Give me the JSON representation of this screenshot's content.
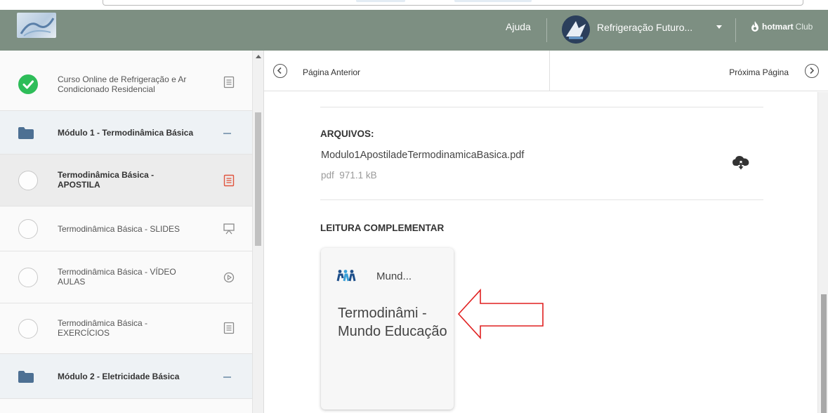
{
  "header": {
    "help_label": "Ajuda",
    "account_name": "Refrigeração Futuro...",
    "brand": "hotmart",
    "brand_suffix": "Club"
  },
  "sidebar": {
    "items": [
      {
        "label": "Curso Online de Refrigeração e Ar Condicionado Residencial",
        "kind": "lesson",
        "status": "completed",
        "icon": "document-icon"
      },
      {
        "label": "Módulo 1 - Termodinâmica Básica",
        "kind": "module",
        "icon": "folder-icon"
      },
      {
        "label": "Termodinâmica Básica - APOSTILA",
        "kind": "lesson",
        "status": "incomplete",
        "active": true,
        "icon": "document-icon"
      },
      {
        "label": "Termodinâmica Básica - SLIDES",
        "kind": "lesson",
        "status": "incomplete",
        "icon": "presentation-icon"
      },
      {
        "label": "Termodinâmica Básica - VÍDEO AULAS",
        "kind": "lesson",
        "status": "incomplete",
        "icon": "play-icon"
      },
      {
        "label": "Termodinâmica Básica - EXERCÍCIOS",
        "kind": "lesson",
        "status": "incomplete",
        "icon": "document-icon"
      },
      {
        "label": "Módulo 2 - Eletricidade Básica",
        "kind": "module",
        "icon": "folder-icon"
      }
    ]
  },
  "pager": {
    "prev_label": "Página Anterior",
    "next_label": "Próxima Página"
  },
  "content": {
    "files_title": "ARQUIVOS:",
    "file": {
      "name": "Modulo1ApostiladeTermodinamicaBasica.pdf",
      "type": "pdf",
      "size": "971.1 kB"
    },
    "reading_title": "LEITURA COMPLEMENTAR",
    "link_card": {
      "site_name": "Mund...",
      "title": "Termodinâmi - Mundo Educação"
    }
  },
  "colors": {
    "topbar": "#7d8f82",
    "completed": "#2ebd59",
    "active_doc_icon": "#e0543e",
    "annotation_arrow": "#e02020"
  }
}
